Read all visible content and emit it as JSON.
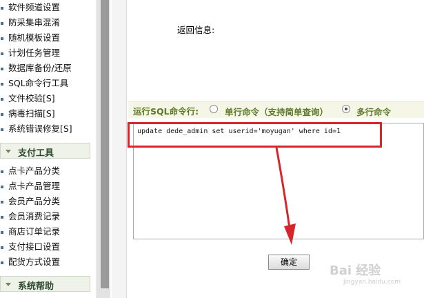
{
  "sidebar": {
    "items": [
      {
        "label": "软件频道设置"
      },
      {
        "label": "防采集串混淆"
      },
      {
        "label": "随机模板设置"
      },
      {
        "label": "计划任务管理"
      },
      {
        "label": "数据库备份/还原"
      },
      {
        "label": "SQL命令行工具"
      },
      {
        "label": "文件校验[S]"
      },
      {
        "label": "病毒扫描[S]"
      },
      {
        "label": "系统错误修复[S]"
      }
    ],
    "payment_header": "支付工具",
    "payment_items": [
      {
        "label": "点卡产品分类"
      },
      {
        "label": "点卡产品管理"
      },
      {
        "label": "会员产品分类"
      },
      {
        "label": "会员消费记录"
      },
      {
        "label": "商店订单记录"
      },
      {
        "label": "支付接口设置"
      },
      {
        "label": "配货方式设置"
      }
    ],
    "help_header": "系统帮助"
  },
  "main": {
    "return_label": "返回信息:",
    "command_title": "运行SQL命令行:",
    "radio_single": {
      "label": "单行命令（支持简单查询）",
      "checked": false
    },
    "radio_multi": {
      "label": "多行命令",
      "checked": true
    },
    "sql_text": "update dede_admin set userid='moyugan' where id=1",
    "confirm_label": "确定"
  },
  "watermark": {
    "main": "Bai 经验",
    "sub": "jingyan.baidu.com"
  },
  "colors": {
    "accent": "#5d7a2a",
    "highlight": "#d6262c"
  }
}
